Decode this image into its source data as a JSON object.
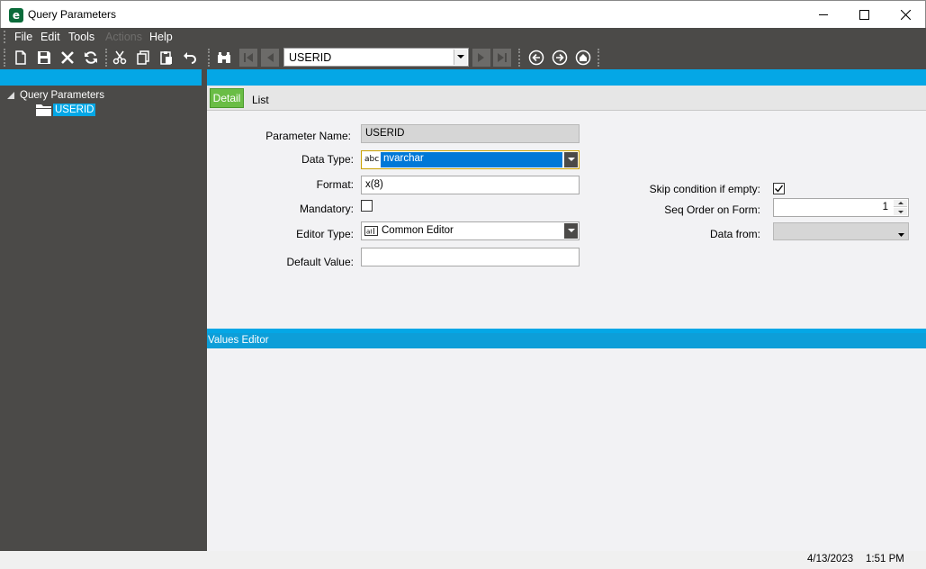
{
  "window": {
    "title": "Query Parameters",
    "app_icon_letter": "e"
  },
  "menu": {
    "items": [
      {
        "label": "File",
        "enabled": true
      },
      {
        "label": "Edit",
        "enabled": true
      },
      {
        "label": "Tools",
        "enabled": true
      },
      {
        "label": "Actions",
        "enabled": false
      },
      {
        "label": "Help",
        "enabled": true
      }
    ]
  },
  "toolbar": {
    "icons": [
      "new-icon",
      "save-icon",
      "delete-icon",
      "refresh-icon",
      "cut-icon",
      "copy-icon",
      "paste-icon",
      "undo-icon",
      "search-binoculars-icon",
      "first-record-icon",
      "previous-record-icon",
      "next-record-icon",
      "last-record-icon",
      "back-icon",
      "forward-icon",
      "home-icon"
    ],
    "record_value": "USERID"
  },
  "tree": {
    "root_label": "Query Parameters",
    "child_label": "USERID"
  },
  "tabs": {
    "detail": "Detail",
    "list": "List"
  },
  "form": {
    "parameter_name_label": "Parameter Name:",
    "parameter_name_value": "USERID",
    "data_type_label": "Data Type:",
    "data_type_prefix": "abc",
    "data_type_value": "nvarchar",
    "format_label": "Format:",
    "format_value": "x(8)",
    "mandatory_label": "Mandatory:",
    "mandatory_checked": false,
    "editor_type_label": "Editor Type:",
    "editor_type_value": "Common Editor",
    "default_value_label": "Default Value:",
    "default_value_value": "",
    "skip_condition_label": "Skip condition if empty:",
    "skip_condition_checked": true,
    "seq_order_label": "Seq Order on Form:",
    "seq_order_value": "1",
    "data_from_label": "Data from:",
    "data_from_value": ""
  },
  "values_editor": {
    "title": "Values Editor"
  },
  "status": {
    "date": "4/13/2023",
    "time": "1:51 PM"
  },
  "colors": {
    "accent_blue": "#04a7e6",
    "tab_active_green": "#6abd45",
    "dark_chrome": "#4b4a48",
    "selection_blue": "#0078d7"
  }
}
